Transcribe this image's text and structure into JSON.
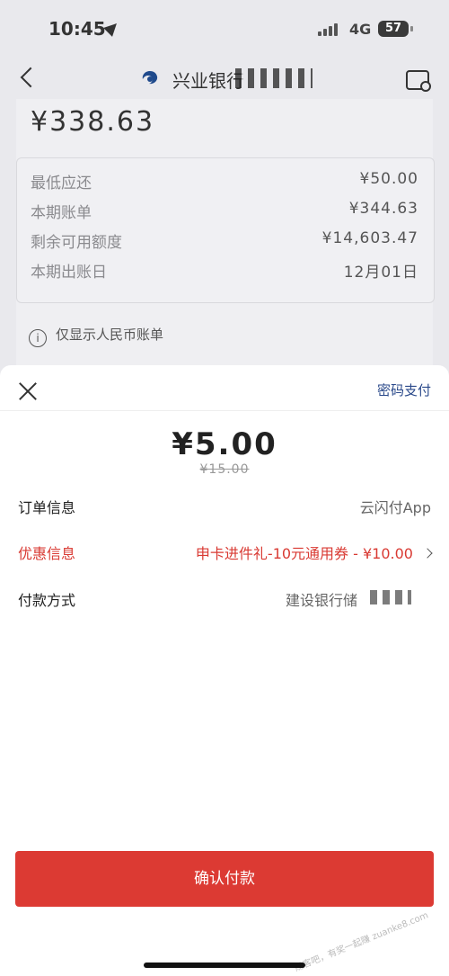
{
  "status_bar": {
    "time": "10:45",
    "network": "4G",
    "battery": "57"
  },
  "header": {
    "bank_name": "兴业银行"
  },
  "bill": {
    "balance": "¥338.63",
    "rows": [
      {
        "label": "最低应还",
        "value": "¥50.00"
      },
      {
        "label": "本期账单",
        "value": "¥344.63"
      },
      {
        "label": "剩余可用额度",
        "value": "¥14,603.47"
      },
      {
        "label": "本期出账日",
        "value": "12月01日"
      }
    ],
    "note": "仅显示人民币账单"
  },
  "sheet": {
    "password_pay": "密码支付",
    "pay_amount": "¥5.00",
    "original_amount": "¥15.00",
    "order_label": "订单信息",
    "order_value": "云闪付App",
    "discount_label": "优惠信息",
    "discount_value": "申卡进件礼-10元通用券 - ¥10.00",
    "method_label": "付款方式",
    "method_value": "建设银行储",
    "confirm_label": "确认付款"
  },
  "watermark": "赚客吧，有奖一起赚 zuanke8.com",
  "colors": {
    "accent_red": "#dc3a33",
    "link_blue": "#2b4a8b"
  }
}
